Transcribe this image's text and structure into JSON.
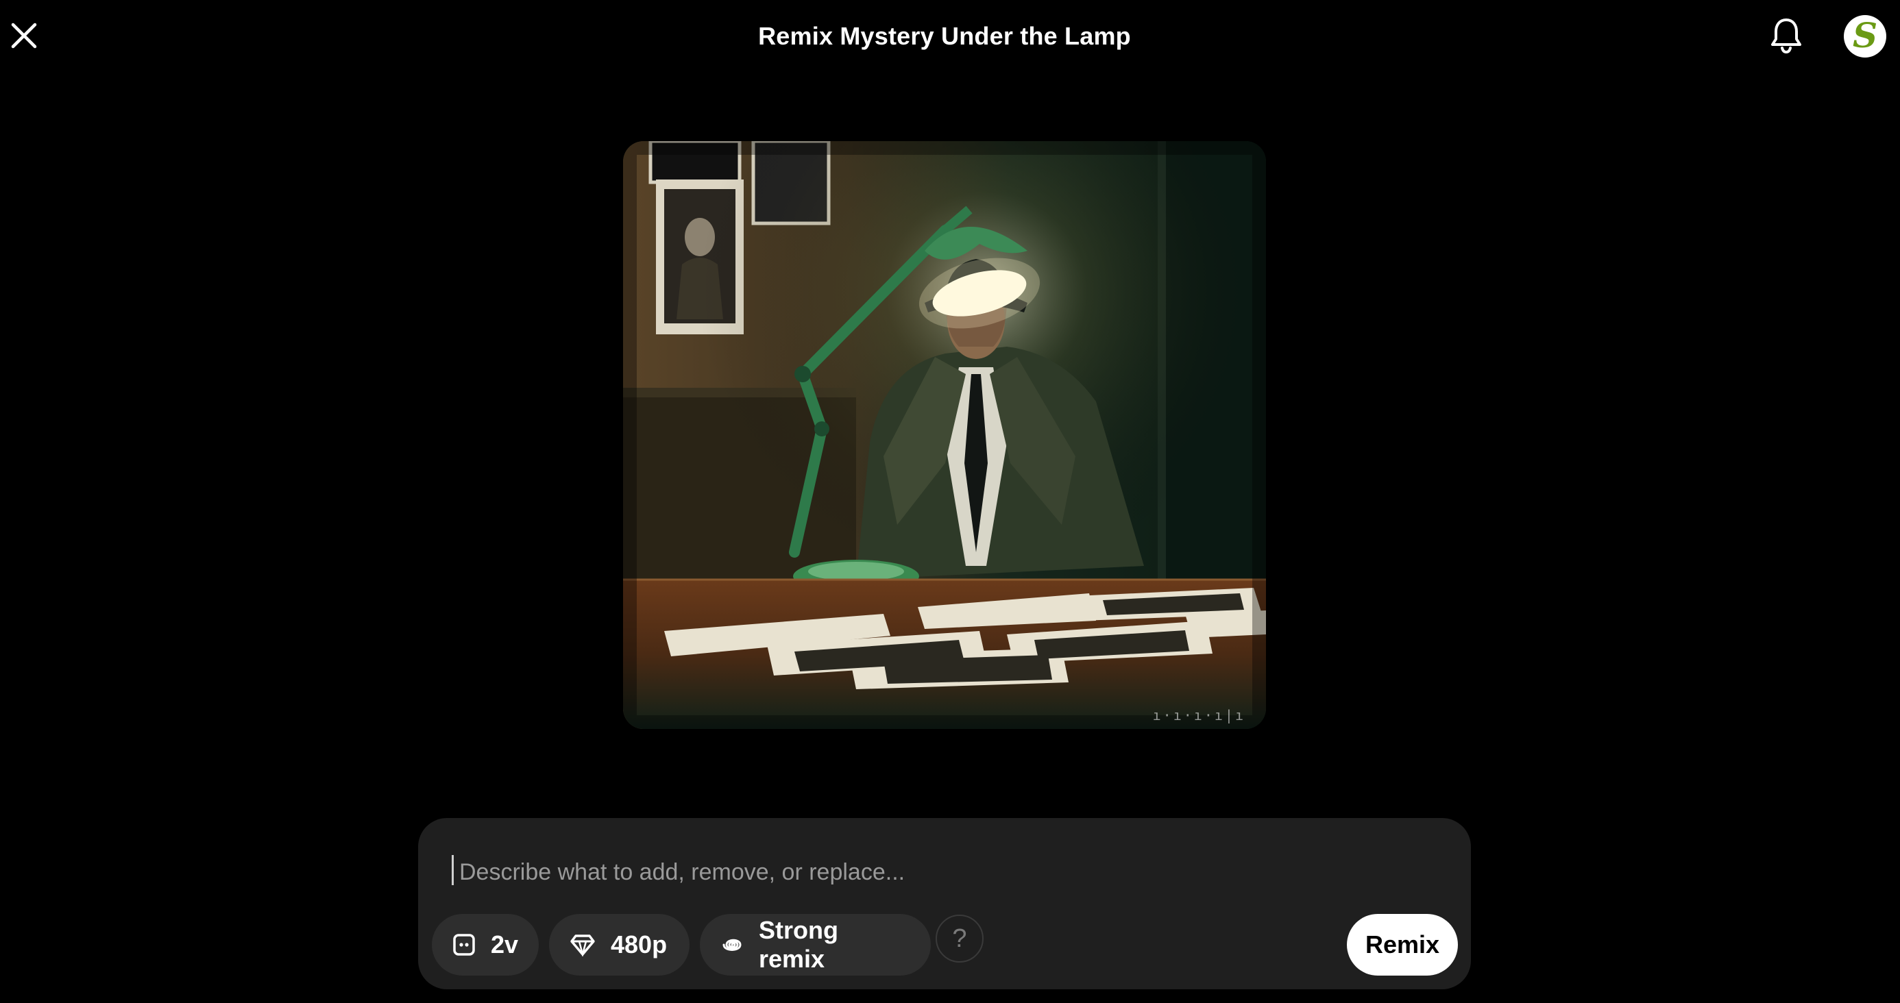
{
  "header": {
    "title": "Remix Mystery Under the Lamp",
    "close_icon": "close-icon",
    "notification_icon": "bell-icon",
    "avatar_letter": "S",
    "avatar_color": "#6a9a14"
  },
  "preview": {
    "watermark": "ı·ı·ı·ı|ı"
  },
  "prompt": {
    "value": "",
    "placeholder": "Describe what to add, remove, or replace..."
  },
  "options": {
    "versions": {
      "icon": "versions-icon",
      "label": "2v"
    },
    "resolution": {
      "icon": "diamond-icon",
      "label": "480p"
    },
    "strength": {
      "icon": "spiral-icon",
      "label": "Strong remix"
    },
    "help_label": "?"
  },
  "actions": {
    "remix_label": "Remix"
  },
  "colors": {
    "background": "#000000",
    "panel": "#1f1f1f",
    "chip": "#2e2e2e",
    "primary_button": "#ffffff"
  }
}
